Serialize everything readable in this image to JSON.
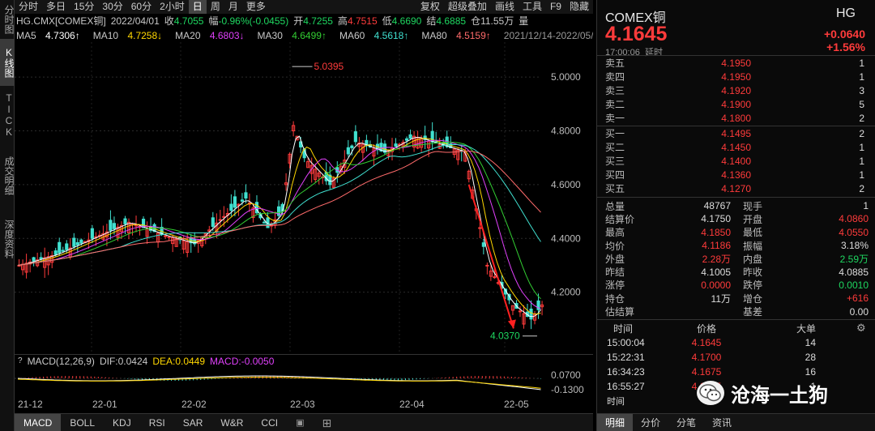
{
  "side_tabs": [
    "分时图",
    "K线图",
    "TICK",
    "成交明细",
    "深度资料"
  ],
  "toolbar": {
    "periods": [
      "分时",
      "多日",
      "15分",
      "30分",
      "60分",
      "2小时",
      "日",
      "周",
      "月",
      "更多"
    ],
    "active_period": "日",
    "right": [
      "复权",
      "超级叠加",
      "画线",
      "工具",
      "F9",
      "隐藏"
    ]
  },
  "info": {
    "symbol": "HG.CMX[COMEX铜]",
    "date": "2022/04/01",
    "close_label": "收",
    "close": "4.7055",
    "change_label": "幅",
    "change": "-0.96%(-0.0455)",
    "open_label": "开",
    "open": "4.7255",
    "high_label": "高",
    "high": "4.7515",
    "low_label": "低",
    "low": "4.6690",
    "settle_label": "结",
    "settle": "4.6885",
    "oi_label": "仓",
    "oi": "11.55万",
    "vol_label": "量"
  },
  "ma": [
    {
      "label": "MA5",
      "value": "4.7306↑",
      "color": "#ffffff"
    },
    {
      "label": "MA10",
      "value": "4.7258↓",
      "color": "#ffd700"
    },
    {
      "label": "MA20",
      "value": "4.6803↓",
      "color": "#e040fb"
    },
    {
      "label": "MA30",
      "value": "4.6499↑",
      "color": "#32cd32"
    },
    {
      "label": "MA60",
      "value": "4.5618↑",
      "color": "#40e0d0"
    },
    {
      "label": "MA80",
      "value": "4.5159↑",
      "color": "#ff6b6b"
    }
  ],
  "ma_overlay_text": "2021/12/14-2022/05/13(110日)",
  "chart": {
    "yticks": [
      "5.0000",
      "4.8000",
      "4.6000",
      "4.4000",
      "4.2000"
    ],
    "high_marker": "5.0395",
    "low_marker": "4.0370",
    "up_color": "#ff3b3b",
    "down_color": "#40e0d0"
  },
  "macd": {
    "label": "MACD(12,26,9)",
    "dif_label": "DIF:",
    "dif": "0.0424",
    "dea_label": "DEA:",
    "dea": "0.0449",
    "macd_label": "MACD:",
    "macd": "-0.0050",
    "yticks": [
      "0.0700",
      "-0.1300"
    ]
  },
  "dates": [
    "21-12",
    "22-01",
    "22-02",
    "22-03",
    "22-04",
    "22-05"
  ],
  "bottom_tabs": [
    "MACD",
    "BOLL",
    "KDJ",
    "RSI",
    "SAR",
    "W&R",
    "CCI"
  ],
  "quote": {
    "name": "COMEX铜",
    "code": "HG",
    "price": "4.1645",
    "change": "+0.0640",
    "change_pct": "+1.56%",
    "time": "17:00:06",
    "status": "延时"
  },
  "asks": [
    {
      "label": "卖五",
      "price": "4.1950",
      "vol": "1"
    },
    {
      "label": "卖四",
      "price": "4.1950",
      "vol": "1"
    },
    {
      "label": "卖三",
      "price": "4.1920",
      "vol": "3"
    },
    {
      "label": "卖二",
      "price": "4.1900",
      "vol": "5"
    },
    {
      "label": "卖一",
      "price": "4.1800",
      "vol": "2"
    }
  ],
  "bids": [
    {
      "label": "买一",
      "price": "4.1495",
      "vol": "2"
    },
    {
      "label": "买二",
      "price": "4.1450",
      "vol": "1"
    },
    {
      "label": "买三",
      "price": "4.1400",
      "vol": "1"
    },
    {
      "label": "买四",
      "price": "4.1360",
      "vol": "1"
    },
    {
      "label": "买五",
      "price": "4.1270",
      "vol": "2"
    }
  ],
  "stats": [
    {
      "k1": "总量",
      "v1": "48767",
      "c1": "",
      "k2": "现手",
      "v2": "1",
      "c2": ""
    },
    {
      "k1": "结算价",
      "v1": "4.1750",
      "c1": "",
      "k2": "开盘",
      "v2": "4.0860",
      "c2": "red"
    },
    {
      "k1": "最高",
      "v1": "4.1850",
      "c1": "red",
      "k2": "最低",
      "v2": "4.0550",
      "c2": "red"
    },
    {
      "k1": "均价",
      "v1": "4.1186",
      "c1": "red",
      "k2": "振幅",
      "v2": "3.18%",
      "c2": ""
    },
    {
      "k1": "外盘",
      "v1": "2.28万",
      "c1": "red",
      "k2": "内盘",
      "v2": "2.59万",
      "c2": "green"
    },
    {
      "k1": "昨结",
      "v1": "4.1005",
      "c1": "",
      "k2": "昨收",
      "v2": "4.0885",
      "c2": ""
    },
    {
      "k1": "涨停",
      "v1": "0.0000",
      "c1": "red",
      "k2": "跌停",
      "v2": "0.0010",
      "c2": "green"
    },
    {
      "k1": "持仓",
      "v1": "11万",
      "c1": "",
      "k2": "增仓",
      "v2": "+616",
      "c2": "red"
    },
    {
      "k1": "估结算",
      "v1": "",
      "c1": "",
      "k2": "基差",
      "v2": "0.00",
      "c2": ""
    }
  ],
  "trades_head": {
    "time": "时间",
    "price": "价格",
    "vol": "大单"
  },
  "trades": [
    {
      "time": "15:00:04",
      "price": "4.1645",
      "vol": "14"
    },
    {
      "time": "15:22:31",
      "price": "4.1700",
      "vol": "28"
    },
    {
      "time": "16:34:23",
      "price": "4.1675",
      "vol": "16"
    },
    {
      "time": "16:55:27",
      "price": "4.1645",
      "vol": "1"
    }
  ],
  "panel_tabs": [
    "明细",
    "分价",
    "分笔",
    "资讯"
  ],
  "watermark": "沧海一土狗",
  "truncated_label": "时间"
}
